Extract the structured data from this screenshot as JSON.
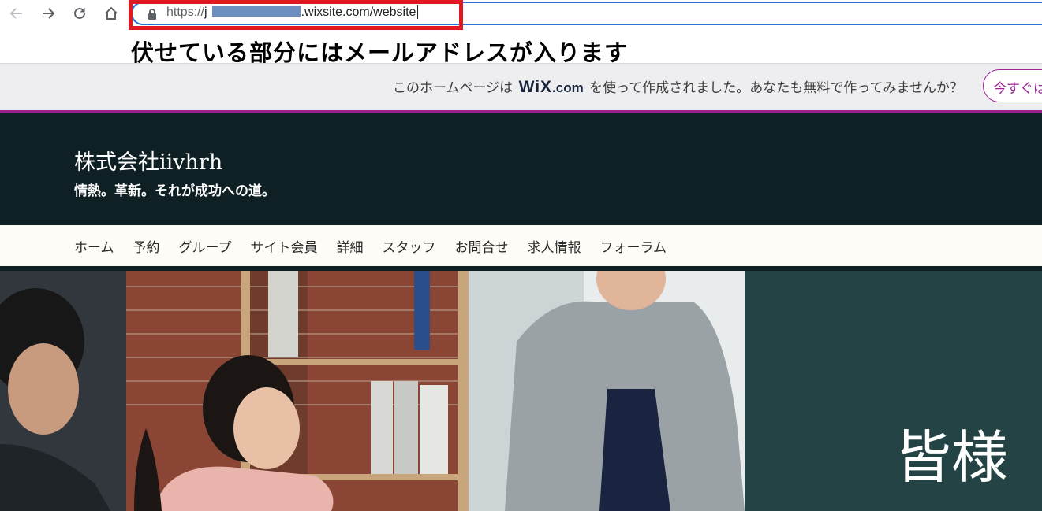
{
  "browser": {
    "url_scheme": "https://",
    "url_prefix": "j",
    "url_suffix": ".wixsite.com/website",
    "icons": [
      "back-arrow-icon",
      "forward-arrow-icon",
      "reload-icon",
      "home-icon",
      "lock-icon"
    ]
  },
  "annotation": {
    "note": "伏せている部分にはメールアドレスが入ります",
    "highlight_color": "#e0181f"
  },
  "wix_banner": {
    "message_before": "このホームページは",
    "logo_wix": "WiX",
    "logo_dotcom": ".com",
    "message_after": "を使って作成されました。あなたも無料で作ってみませんか？",
    "cta": "今すぐは",
    "accent_color": "#9b1f8c"
  },
  "site": {
    "title": "株式会社iivhrh",
    "tagline": "情熱。革新。それが成功への道。",
    "nav": [
      "ホーム",
      "予約",
      "グループ",
      "サイト会員",
      "詳細",
      "スタッフ",
      "お問合せ",
      "求人情報",
      "フォーラム"
    ],
    "hero_text": "皆様",
    "colors": {
      "header_bg": "#0e2024",
      "nav_bg": "#fefcf6",
      "hero_panel": "#244344"
    }
  }
}
